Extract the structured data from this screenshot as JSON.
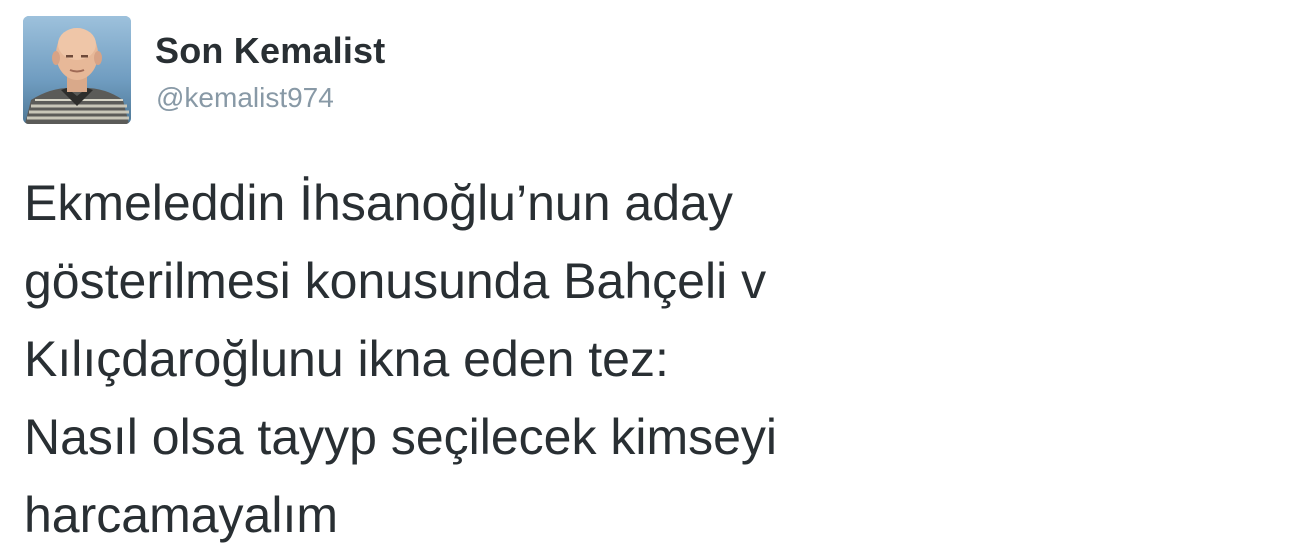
{
  "author": {
    "display_name": "Son Kemalist",
    "handle": "@kemalist974",
    "avatar_icon": "profile-photo"
  },
  "tweet": {
    "lines": [
      "Ekmeleddin İhsanoğlu’nun aday",
      "gösterilmesi konusunda Bahçeli v",
      "Kılıçdaroğlunu ikna eden tez:",
      "Nasıl olsa tayyp seçilecek kimseyi",
      "harcamayalım"
    ]
  },
  "colors": {
    "text": "#292f33",
    "handle": "#8899a6",
    "background": "#ffffff"
  }
}
